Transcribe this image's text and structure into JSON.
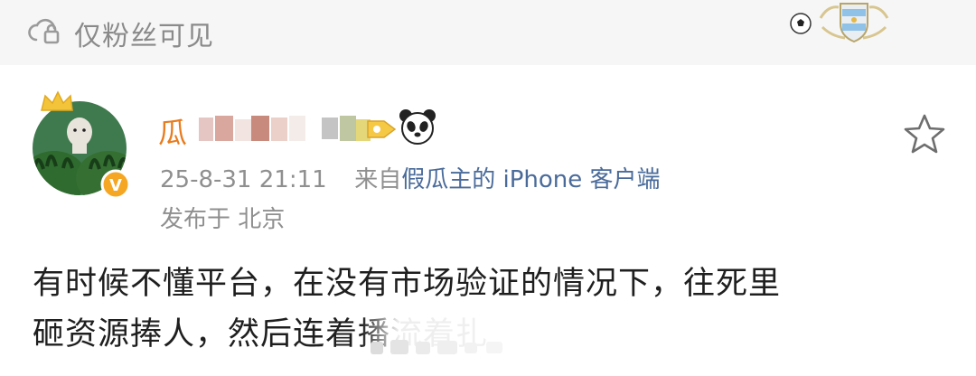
{
  "privacy_bar": {
    "label": "仅粉丝可见",
    "icon": "cloud-lock-icon"
  },
  "post": {
    "author": {
      "name_visible": "瓜",
      "avatar": "watermelon-avatar",
      "verified_badge": "v-badge-icon",
      "crown": "crown-icon"
    },
    "timestamp": "25-8-31 21:11",
    "source_prefix": "来自",
    "source_name": "假瓜主的 iPhone 客户端",
    "location": "发布于 北京",
    "text_line1": "有时候不懂平台，在没有市场验证的情况下，往死里",
    "text_line2": "砸资源捧人，然后连着播流着扎"
  },
  "colors": {
    "name_accent": "#e87c1e",
    "meta_gray": "#8f8f8f",
    "source_blue": "#4a6b9a",
    "privacy_bg": "#f6f6f6"
  }
}
